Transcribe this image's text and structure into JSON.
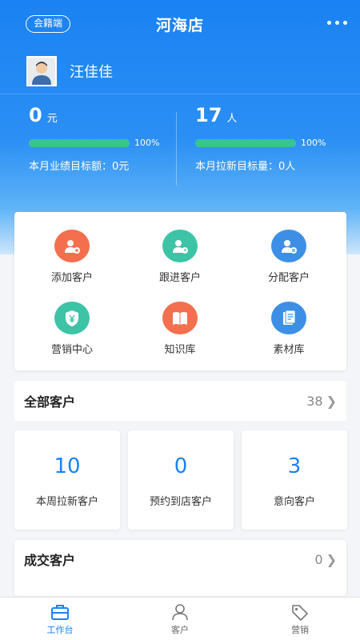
{
  "header": {
    "badge": "会籍端",
    "title": "河海店"
  },
  "user": {
    "name": "汪佳佳"
  },
  "stats": {
    "performance": {
      "value": "0",
      "unit": "元",
      "percent": "100%",
      "progress": 1.0,
      "note": "本月业绩目标额：0元"
    },
    "newcomers": {
      "value": "17",
      "unit": "人",
      "percent": "100%",
      "progress": 1.0,
      "note": "本月拉新目标量：0人"
    }
  },
  "grid": [
    {
      "label": "添加客户",
      "icon": "add-user-icon",
      "color": "#f36f4d"
    },
    {
      "label": "跟进客户",
      "icon": "follow-user-icon",
      "color": "#3dc3a6"
    },
    {
      "label": "分配客户",
      "icon": "assign-user-icon",
      "color": "#3d8fe6"
    },
    {
      "label": "营销中心",
      "icon": "yen-shield-icon",
      "color": "#3dc3a6"
    },
    {
      "label": "知识库",
      "icon": "book-icon",
      "color": "#f36f4d"
    },
    {
      "label": "素材库",
      "icon": "document-icon",
      "color": "#3d8fe6"
    }
  ],
  "all_customers": {
    "title": "全部客户",
    "count": "38",
    "cards": [
      {
        "value": "10",
        "label": "本周拉新客户"
      },
      {
        "value": "0",
        "label": "预约到店客户"
      },
      {
        "value": "3",
        "label": "意向客户"
      }
    ]
  },
  "deal_customers": {
    "title": "成交客户",
    "count": "0"
  },
  "tabs": [
    {
      "label": "工作台",
      "icon": "briefcase-icon",
      "active": true
    },
    {
      "label": "客户",
      "icon": "customer-icon",
      "active": false
    },
    {
      "label": "营销",
      "icon": "tag-icon",
      "active": false
    }
  ],
  "colors": {
    "primary": "#1a82f2",
    "progress": "#37c58f"
  }
}
